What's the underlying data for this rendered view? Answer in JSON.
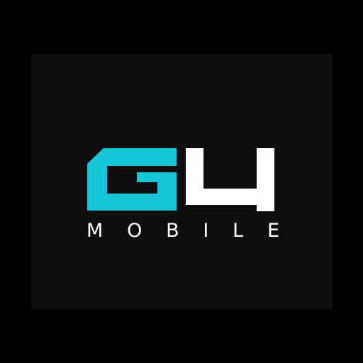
{
  "logo": {
    "brand_text": "G4",
    "wordmark": "MOBILE",
    "colors": {
      "background": "#000000",
      "card": "#0e0e0e",
      "g_glyph": "#15c6d6",
      "four_glyph": "#ffffff",
      "wordmark": "#ffffff"
    }
  }
}
